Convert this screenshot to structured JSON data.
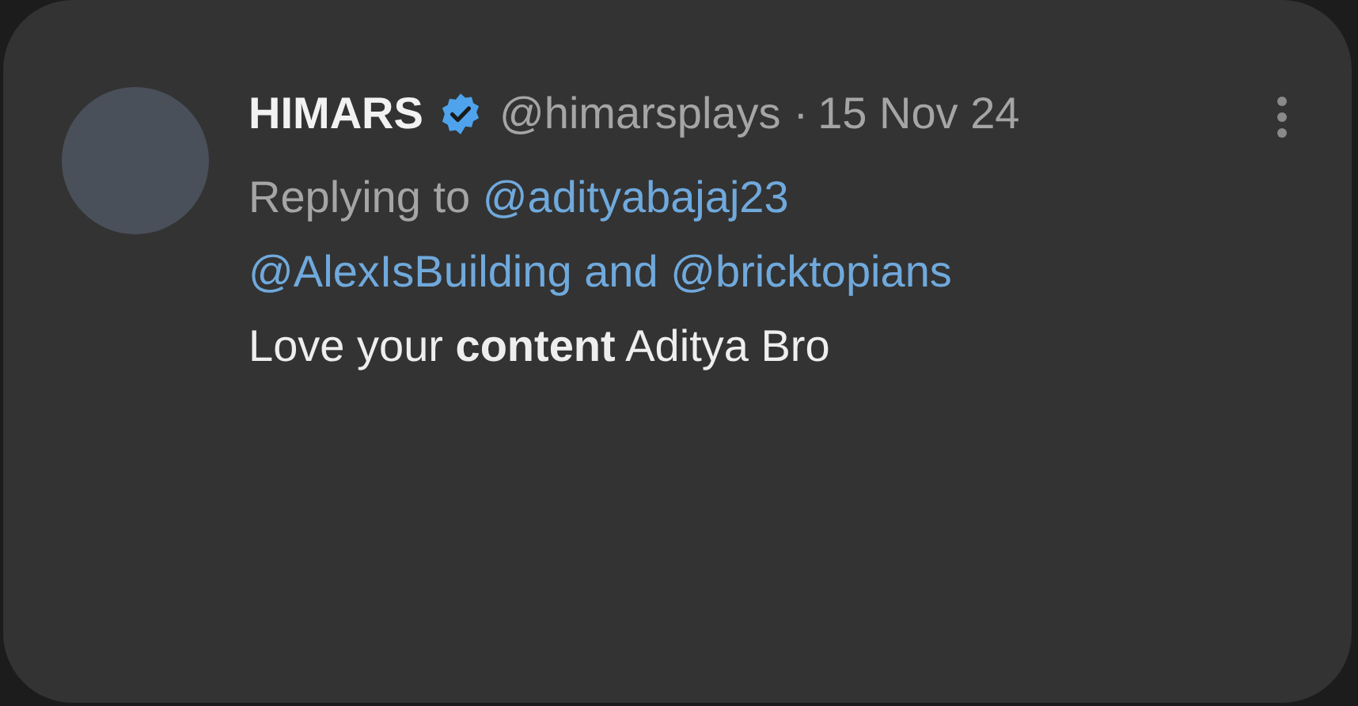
{
  "post": {
    "author": {
      "name": "HIMARS",
      "verified": true,
      "handle": "@himarsplays"
    },
    "separator": "·",
    "date": "15 Nov 24",
    "reply": {
      "prefix": "Replying to",
      "mentions": [
        "@adityabajaj23",
        "@AlexIsBuilding",
        "@bricktopians"
      ],
      "conjunction": "and"
    },
    "text": "Love your **content** Aditya Bro"
  }
}
